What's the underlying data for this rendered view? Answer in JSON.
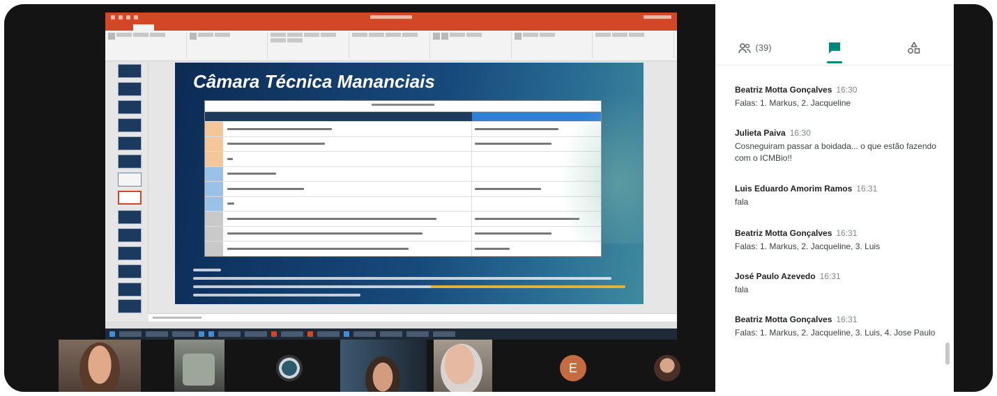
{
  "slide": {
    "title": "Câmara Técnica Mananciais"
  },
  "chat": {
    "tabs": [
      {
        "label": "(39)",
        "icon": "people-icon"
      },
      {
        "label": "",
        "icon": "chat-icon"
      },
      {
        "label": "",
        "icon": "activities-icon"
      }
    ],
    "messages": [
      {
        "author": "Beatriz Motta Gonçalves",
        "time": "16:30",
        "text": "Falas: 1. Markus, 2. Jacqueline"
      },
      {
        "author": "Julieta Paiva",
        "time": "16:30",
        "text": "Cosneguiram passar a boidada... o que estão fazendo com o ICMBio!!"
      },
      {
        "author": "Luis Eduardo Amorim Ramos",
        "time": "16:31",
        "text": "fala"
      },
      {
        "author": "Beatriz Motta Gonçalves",
        "time": "16:31",
        "text": "Falas: 1. Markus, 2. Jacqueline, 3. Luis"
      },
      {
        "author": "José Paulo Azevedo",
        "time": "16:31",
        "text": "fala"
      },
      {
        "author": "Beatriz Motta Gonçalves",
        "time": "16:31",
        "text": "Falas: 1. Markus, 2. Jacqueline, 3. Luis, 4. Jose Paulo"
      }
    ]
  },
  "participants": [
    {
      "kind": "video"
    },
    {
      "kind": "video"
    },
    {
      "kind": "video"
    },
    {
      "kind": "video"
    },
    {
      "kind": "video"
    },
    {
      "kind": "avatar",
      "initial": "E",
      "color": "#c66a3f"
    },
    {
      "kind": "video"
    }
  ],
  "colors": {
    "ppt_accent": "#d24726",
    "chat_active": "#00897b"
  }
}
